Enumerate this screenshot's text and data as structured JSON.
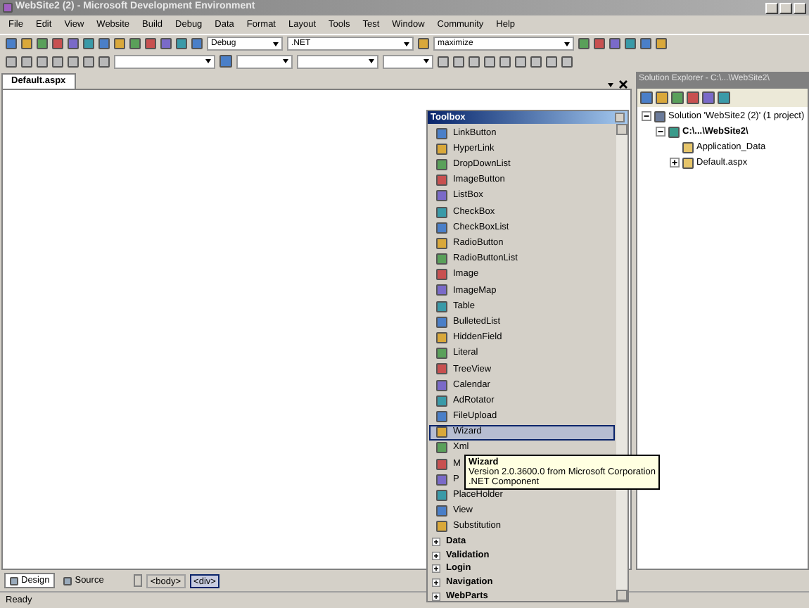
{
  "window": {
    "title": "WebSite2 (2) - Microsoft Development Environment"
  },
  "menu": [
    "File",
    "Edit",
    "View",
    "Website",
    "Build",
    "Debug",
    "Data",
    "Format",
    "Layout",
    "Tools",
    "Test",
    "Window",
    "Community",
    "Help"
  ],
  "toolbar": {
    "configuration": "Debug",
    "platform": ".NET",
    "find": "maximize"
  },
  "document_tabs": [
    {
      "label": "Default.aspx",
      "selected": true
    }
  ],
  "toolbox": {
    "title": "Toolbox",
    "items": [
      {
        "label": "LinkButton",
        "selected": false
      },
      {
        "label": "HyperLink",
        "selected": false
      },
      {
        "label": "DropDownList",
        "selected": false
      },
      {
        "label": "ImageButton",
        "selected": false
      },
      {
        "label": "ListBox",
        "selected": false
      },
      {
        "label": "CheckBox",
        "selected": false
      },
      {
        "label": "CheckBoxList",
        "selected": false
      },
      {
        "label": "RadioButton",
        "selected": false
      },
      {
        "label": "RadioButtonList",
        "selected": false
      },
      {
        "label": "Image",
        "selected": false
      },
      {
        "label": "ImageMap",
        "selected": false
      },
      {
        "label": "Table",
        "selected": false
      },
      {
        "label": "BulletedList",
        "selected": false
      },
      {
        "label": "HiddenField",
        "selected": false
      },
      {
        "label": "Literal",
        "selected": false
      },
      {
        "label": "TreeView",
        "selected": false
      },
      {
        "label": "Calendar",
        "selected": false
      },
      {
        "label": "AdRotator",
        "selected": false
      },
      {
        "label": "FileUpload",
        "selected": false
      },
      {
        "label": "Wizard",
        "selected": true
      },
      {
        "label": "Xml",
        "selected": false
      },
      {
        "label": "M",
        "selected": false
      },
      {
        "label": "P",
        "selected": false
      },
      {
        "label": "PlaceHolder",
        "selected": false
      },
      {
        "label": "View",
        "selected": false
      },
      {
        "label": "Substitution",
        "selected": false
      }
    ],
    "categories": [
      {
        "label": "Data",
        "expanded": false
      },
      {
        "label": "Validation",
        "expanded": false
      },
      {
        "label": "Login",
        "expanded": false
      },
      {
        "label": "Navigation",
        "expanded": false
      },
      {
        "label": "WebParts",
        "expanded": false
      }
    ],
    "tooltip": {
      "title": "Wizard",
      "lines": [
        "Version 2.0.3600.0 from Microsoft Corporation",
        ".NET Component"
      ]
    }
  },
  "solution_explorer": {
    "title": "Solution Explorer - C:\\...\\WebSite2\\",
    "tree": [
      {
        "label": "Solution 'WebSite2 (2)' (1 project)",
        "expanded": true,
        "children": [
          {
            "label": "C:\\...\\WebSite2\\",
            "expanded": true,
            "children": [
              {
                "label": "Application_Data"
              },
              {
                "label": "Default.aspx",
                "expanded": false
              }
            ]
          }
        ]
      }
    ]
  },
  "view_tabs": [
    {
      "label": "Design",
      "selected": true
    },
    {
      "label": "Source",
      "selected": false
    }
  ],
  "breadcrumb": [
    {
      "label": "<body>",
      "selected": false
    },
    {
      "label": "<div>",
      "selected": true
    }
  ],
  "status_bar": "Ready"
}
